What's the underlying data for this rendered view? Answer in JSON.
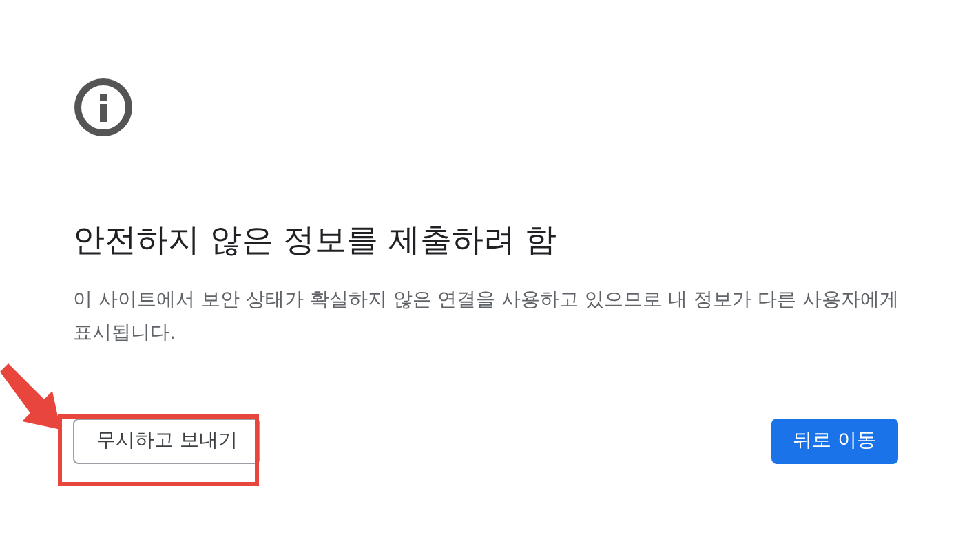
{
  "heading": "안전하지 않은 정보를 제출하려 함",
  "message": "이 사이트에서 보안 상태가 확실하지 않은 연결을 사용하고 있으므로 내 정보가 다른 사용자에게 표시됩니다.",
  "buttons": [
    {
      "label": "무시하고 보내기",
      "kind": "secondary"
    },
    {
      "label": "뒤로 이동",
      "kind": "primary"
    }
  ]
}
